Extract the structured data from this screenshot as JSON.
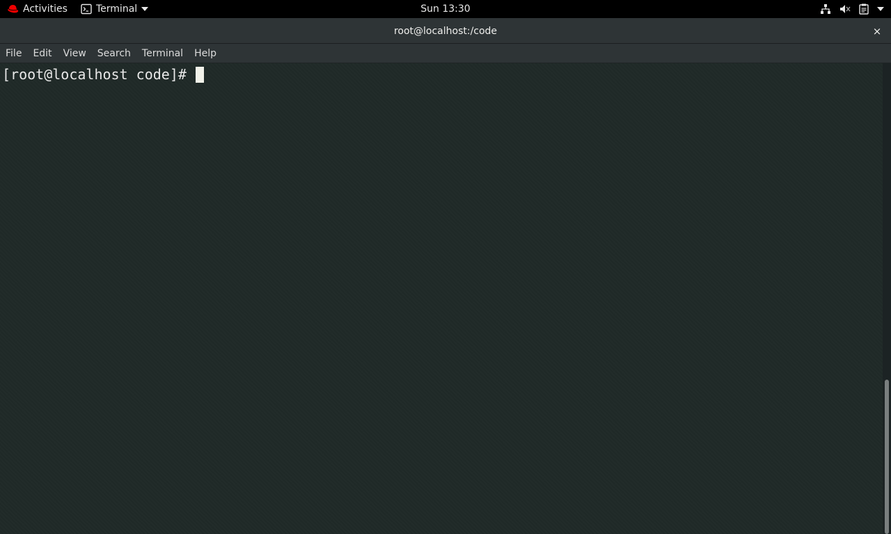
{
  "topbar": {
    "activities_label": "Activities",
    "app_name": "Terminal",
    "clock": "Sun 13:30",
    "tray_icons": [
      "network-wired-icon",
      "volume-muted-icon",
      "battery-clipboard-icon",
      "chevron-down-icon"
    ]
  },
  "window": {
    "title": "root@localhost:/code",
    "close_glyph": "×"
  },
  "menubar": {
    "items": [
      "File",
      "Edit",
      "View",
      "Search",
      "Terminal",
      "Help"
    ]
  },
  "terminal": {
    "prompt": "[root@localhost code]# "
  },
  "colors": {
    "terminal_bg": "#1f2927",
    "chrome_bg": "#2e3436",
    "topbar_bg": "#000000",
    "redhat_red": "#ee0000"
  }
}
